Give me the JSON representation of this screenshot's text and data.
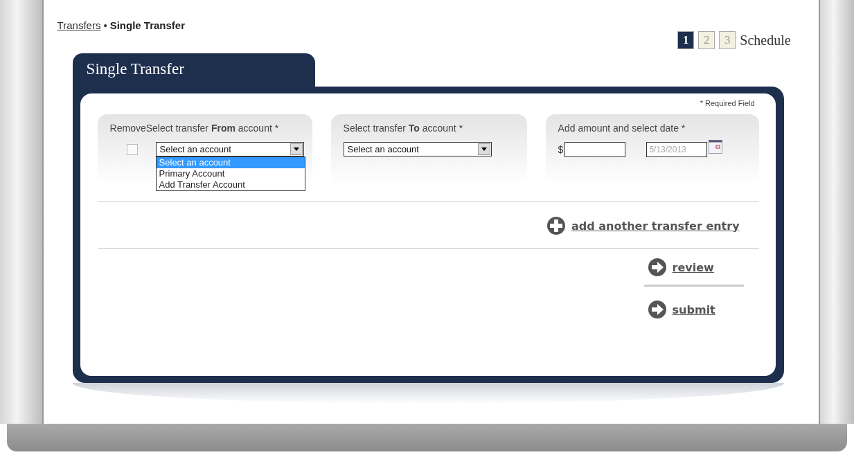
{
  "breadcrumb": {
    "link": "Transfers",
    "separator": "•",
    "current": "Single Transfer"
  },
  "steps": [
    {
      "label": "1",
      "selected": true
    },
    {
      "label": "2",
      "selected": false
    },
    {
      "label": "3",
      "selected": false
    }
  ],
  "steps_caption": "Schedule",
  "panel": {
    "tab_title": "Single Transfer",
    "required_note": "* Required Field",
    "sections": [
      {
        "kind": "account",
        "label": "RemoveSelect transfer **From** account *",
        "remove_checked": false,
        "value": "Select an account",
        "expanded": true,
        "options": [
          {
            "label": "Select an account",
            "selected": true
          },
          {
            "label": "Primary Account",
            "selected": false
          },
          {
            "label": "Add Transfer Account",
            "selected": false
          }
        ]
      },
      {
        "kind": "account",
        "label": "Select transfer **To** account *",
        "value": "Select an account"
      },
      {
        "kind": "amount",
        "label": "Add amount and select date *",
        "currency": "$",
        "date_placeholder": "5/13/2013"
      }
    ],
    "add_link": "add another transfer entry",
    "actions": [
      {
        "label": "review"
      },
      {
        "label": "submit"
      }
    ]
  }
}
